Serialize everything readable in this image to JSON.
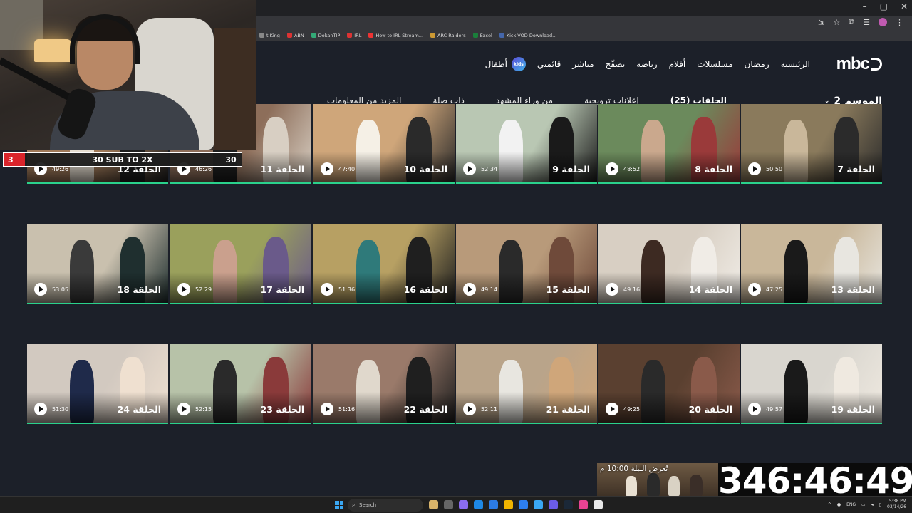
{
  "browser": {
    "bookmarks": [
      "t King",
      "ABN",
      "DokanTIP",
      "IRL",
      "How to IRL Stream...",
      "ARC Raiders",
      "Excel",
      "Kick VOD Download..."
    ],
    "bookmark_colors": [
      "#888",
      "#d33",
      "#3a7",
      "#d33",
      "#e33",
      "#c93",
      "#1a7f3a",
      "#46a"
    ]
  },
  "mbc": {
    "logo": "mbc",
    "nav": [
      "الرئيسية",
      "رمضان",
      "مسلسلات",
      "أفلام",
      "رياضة",
      "تصفّح",
      "مباشر",
      "قائمتي",
      "أطفال"
    ],
    "kids_badge": "kids",
    "season": "الموسم 2",
    "tabs": [
      "الحلقات (25)",
      "إعلانات ترويجية",
      "من وراء المشهد",
      "ذات صلة",
      "المزيد من المعلومات"
    ],
    "episodes": [
      {
        "title": "الحلقة 7",
        "duration": "50:50"
      },
      {
        "title": "الحلقة 8",
        "duration": "48:52"
      },
      {
        "title": "الحلقة 9",
        "duration": "52:34"
      },
      {
        "title": "الحلقة 10",
        "duration": "47:40"
      },
      {
        "title": "الحلقة 11",
        "duration": "46:26"
      },
      {
        "title": "الحلقة 12",
        "duration": "49:26"
      },
      {
        "title": "الحلقة 13",
        "duration": "47:25"
      },
      {
        "title": "الحلقة 14",
        "duration": "49:16"
      },
      {
        "title": "الحلقة 15",
        "duration": "49:14"
      },
      {
        "title": "الحلقة 16",
        "duration": "51:36"
      },
      {
        "title": "الحلقة 17",
        "duration": "52:29"
      },
      {
        "title": "الحلقة 18",
        "duration": "53:05"
      },
      {
        "title": "الحلقة 19",
        "duration": "49:57"
      },
      {
        "title": "الحلقة 20",
        "duration": "49:25"
      },
      {
        "title": "الحلقة 21",
        "duration": "52:11"
      },
      {
        "title": "الحلقة 22",
        "duration": "51:16"
      },
      {
        "title": "الحلقة 23",
        "duration": "52:15"
      },
      {
        "title": "الحلقة 24",
        "duration": "51:30"
      }
    ],
    "preview_label": "تُعرض الليلة 10:00 م"
  },
  "overlay": {
    "sub_left": "3",
    "sub_goal": "30 SUB TO 2X",
    "sub_right": "30",
    "timer": "346:46:49"
  },
  "taskbar": {
    "search": "Search",
    "lang": "ENG",
    "time": "5:38 PM",
    "date": "03/14/26"
  },
  "colors": {
    "accent": "#2ad18c",
    "bg": "#1c2029",
    "sub_red": "#d9242b"
  }
}
